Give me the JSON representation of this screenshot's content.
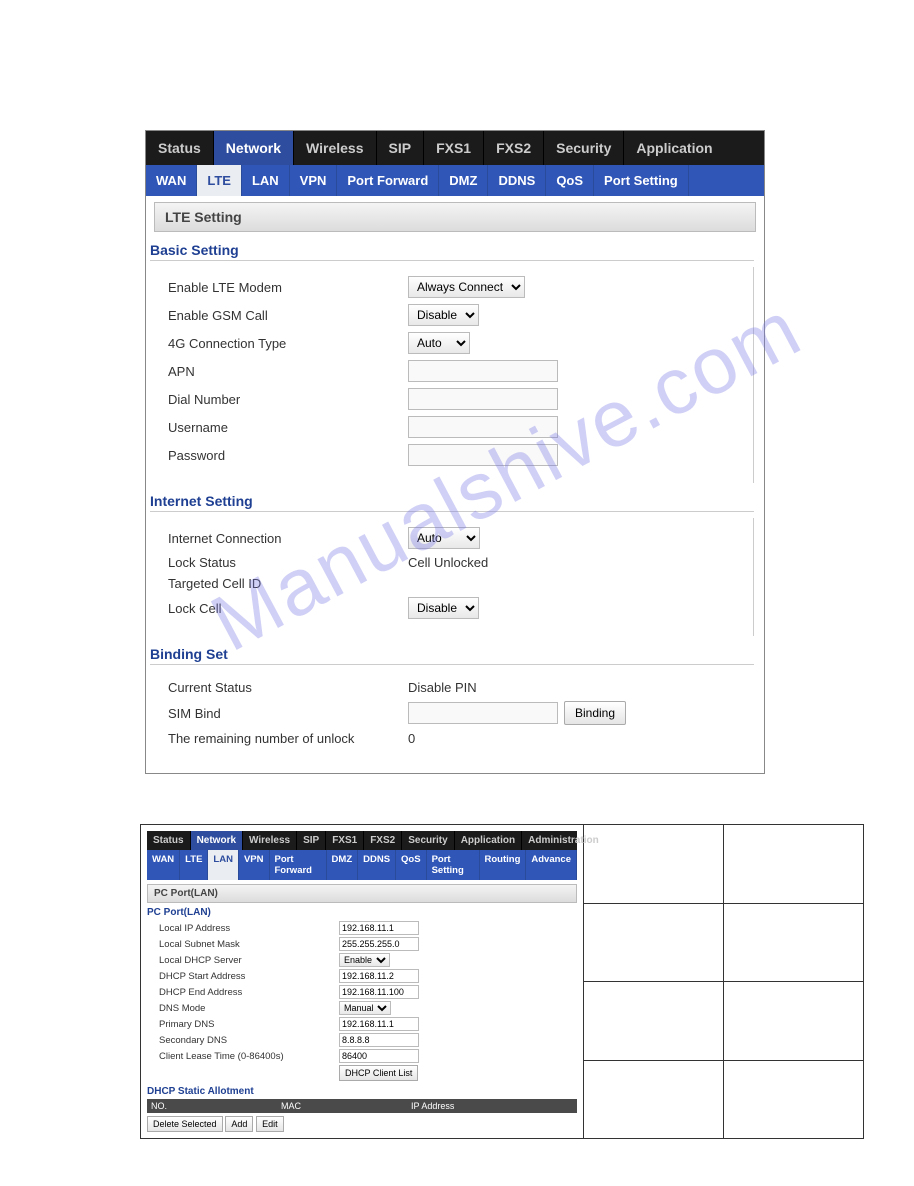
{
  "watermark": "Manualshive.com",
  "panel1": {
    "topnav": [
      "Status",
      "Network",
      "Wireless",
      "SIP",
      "FXS1",
      "FXS2",
      "Security",
      "Application"
    ],
    "topnav_active": 1,
    "subnav": [
      "WAN",
      "LTE",
      "LAN",
      "VPN",
      "Port Forward",
      "DMZ",
      "DDNS",
      "QoS",
      "Port Setting"
    ],
    "subnav_active": 1,
    "page_title": "LTE Setting",
    "basic": {
      "title": "Basic Setting",
      "enable_lte_label": "Enable LTE Modem",
      "enable_lte_value": "Always Connect",
      "enable_gsm_label": "Enable GSM Call",
      "enable_gsm_value": "Disable",
      "conn_type_label": "4G Connection Type",
      "conn_type_value": "Auto",
      "apn_label": "APN",
      "apn_value": "",
      "dial_label": "Dial Number",
      "dial_value": "",
      "user_label": "Username",
      "user_value": "",
      "pass_label": "Password",
      "pass_value": ""
    },
    "internet": {
      "title": "Internet Setting",
      "conn_label": "Internet Connection",
      "conn_value": "Auto",
      "lock_status_label": "Lock Status",
      "lock_status_value": "Cell Unlocked",
      "targeted_label": "Targeted Cell ID",
      "lock_cell_label": "Lock Cell",
      "lock_cell_value": "Disable"
    },
    "binding": {
      "title": "Binding Set",
      "status_label": "Current Status",
      "status_value": "Disable PIN",
      "sim_bind_label": "SIM Bind",
      "sim_bind_value": "",
      "binding_btn": "Binding",
      "remaining_label": "The remaining number of unlock",
      "remaining_value": "0"
    }
  },
  "panel2": {
    "topnav": [
      "Status",
      "Network",
      "Wireless",
      "SIP",
      "FXS1",
      "FXS2",
      "Security",
      "Application",
      "Administration"
    ],
    "topnav_active": 1,
    "subnav": [
      "WAN",
      "LTE",
      "LAN",
      "VPN",
      "Port Forward",
      "DMZ",
      "DDNS",
      "QoS",
      "Port Setting",
      "Routing",
      "Advance"
    ],
    "subnav_active": 2,
    "page_title": "PC Port(LAN)",
    "section_title": "PC Port(LAN)",
    "fields": {
      "local_ip_label": "Local IP Address",
      "local_ip_value": "192.168.11.1",
      "subnet_label": "Local Subnet Mask",
      "subnet_value": "255.255.255.0",
      "dhcp_server_label": "Local DHCP Server",
      "dhcp_server_value": "Enable",
      "dhcp_start_label": "DHCP Start Address",
      "dhcp_start_value": "192.168.11.2",
      "dhcp_end_label": "DHCP End Address",
      "dhcp_end_value": "192.168.11.100",
      "dns_mode_label": "DNS Mode",
      "dns_mode_value": "Manual",
      "primary_dns_label": "Primary DNS",
      "primary_dns_value": "192.168.11.1",
      "secondary_dns_label": "Secondary DNS",
      "secondary_dns_value": "8.8.8.8",
      "lease_label": "Client Lease Time (0-86400s)",
      "lease_value": "86400",
      "client_list_btn": "DHCP Client List"
    },
    "static": {
      "title": "DHCP Static Allotment",
      "col_no": "NO.",
      "col_mac": "MAC",
      "col_ip": "IP Address",
      "delete_btn": "Delete Selected",
      "add_btn": "Add",
      "edit_btn": "Edit"
    }
  }
}
